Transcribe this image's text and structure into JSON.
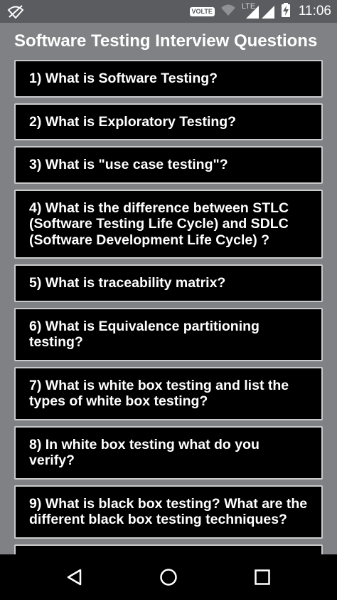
{
  "status_bar": {
    "volte_label": "VOLTE",
    "network_label": "LTE",
    "time": "11:06",
    "icons": [
      "wifi-off-icon",
      "wifi-icon",
      "signal-icon",
      "battery-charging-icon"
    ]
  },
  "page": {
    "title": "Software Testing Interview Questions"
  },
  "questions": [
    "1) What is Software Testing?",
    "2) What is Exploratory Testing?",
    "3) What is \"use case testing\"?",
    "4) What is the difference between STLC (Software Testing Life Cycle) and SDLC (Software Development Life Cycle) ?",
    "5) What is traceability matrix?",
    "6) What is Equivalence partitioning testing?",
    "7) What is white box testing and list the types of white box testing?",
    "8) In white box testing what do you verify?",
    "9) What is black box testing? What are the different black box testing techniques?"
  ],
  "nav_bar": {
    "icons": [
      "back-icon",
      "home-icon",
      "recents-icon"
    ]
  },
  "colors": {
    "background": "#7f8184",
    "status_bar": "#5a5c5f",
    "card": "#000000",
    "card_border": "#c9cacc",
    "text": "#ffffff"
  }
}
